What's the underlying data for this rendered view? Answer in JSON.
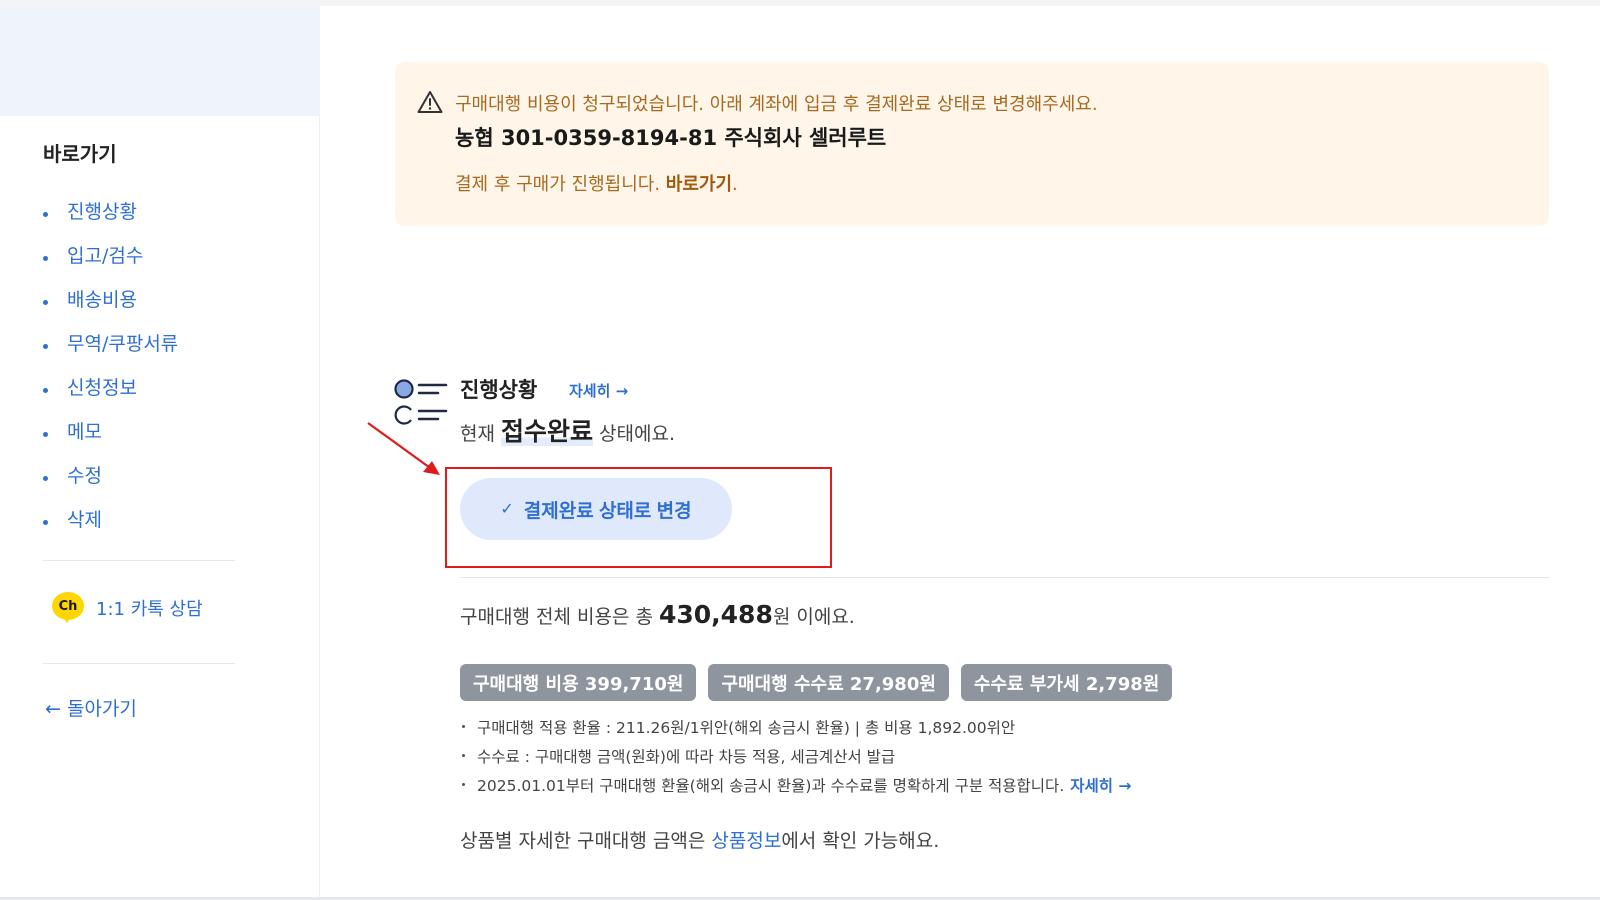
{
  "sidebar": {
    "nav_title": "바로가기",
    "items": [
      {
        "label": "진행상황"
      },
      {
        "label": "입고/검수"
      },
      {
        "label": "배송비용"
      },
      {
        "label": "무역/쿠팡서류"
      },
      {
        "label": "신청정보"
      },
      {
        "label": "메모"
      },
      {
        "label": "수정"
      },
      {
        "label": "삭제"
      }
    ],
    "kakao_badge": "Ch",
    "kakao_label": "1:1 카톡 상담",
    "back_label": "← 돌아가기"
  },
  "alert": {
    "message": "구매대행 비용이 청구되었습니다. 아래 계좌에 입금 후 결제완료 상태로 변경해주세요.",
    "account": "농협 301-0359-8194-81 주식회사 셀러루트",
    "note_prefix": "결제 후 구매가 진행됩니다. ",
    "note_link": "바로가기",
    "note_suffix": "."
  },
  "status": {
    "title": "진행상황",
    "detail_link": "자세히 →",
    "prefix": "현재 ",
    "current": "접수완료",
    "suffix": " 상태에요.",
    "button_label": "결제완료 상태로 변경",
    "button_check": "✓"
  },
  "cost": {
    "prefix": "구매대행 전체 비용은 총 ",
    "total": "430,488",
    "suffix": "원 이에요.",
    "chips": [
      {
        "label": "구매대행 비용 399,710원"
      },
      {
        "label": "구매대행 수수료 27,980원"
      },
      {
        "label": "수수료 부가세 2,798원"
      }
    ],
    "notes": [
      {
        "text": "구매대행 적용 환율 : 211.26원/1위안(해외 송금시 환율) | 총 비용 1,892.00위안"
      },
      {
        "text": "수수료 : 구매대행 금액(원화)에 따라 차등 적용, 세금계산서 발급"
      },
      {
        "text": "2025.01.01부터 구매대행 환율(해외 송금시 환율)과 수수료를 명확하게 구분 적용합니다."
      }
    ],
    "notes_link": "자세히 →",
    "product_prefix": "상품별 자세한 구매대행 금액은 ",
    "product_link": "상품정보",
    "product_suffix": "에서 확인 가능해요."
  },
  "colors": {
    "accent": "#2f6fd1",
    "alert_bg": "#fff5e9",
    "alert_text": "#a66a21",
    "highlight": "#e01b1b",
    "chip_bg": "#8e959e"
  }
}
